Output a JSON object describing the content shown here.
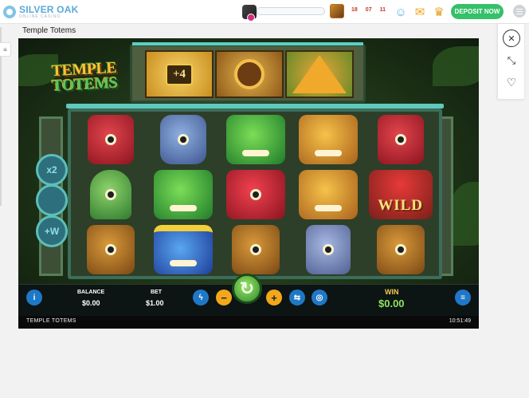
{
  "header": {
    "brand_name": "SILVER OAK",
    "brand_tagline": "ONLINE CASINO",
    "avatar_icon": "user-avatar-icon",
    "level_progress_fraction": 0.0,
    "promo_icon": "promo-chest-icon",
    "countdown": {
      "hours": "18",
      "minutes": "07",
      "seconds": "11"
    },
    "support_icon": "support-agent-icon",
    "mail_icon": "mail-icon",
    "trophy_icon": "trophy-icon",
    "deposit_label": "DEPOSIT NOW",
    "menu_icon": "hamburger-menu-icon",
    "accent_color": "#35c06a",
    "brand_color": "#5aa9d6"
  },
  "page": {
    "game_title": "Temple Totems"
  },
  "side_panel": {
    "close_icon": "close-icon",
    "expand_icon": "fullscreen-icon",
    "favorite_icon": "heart-icon"
  },
  "game": {
    "logo_line1": "TEMPLE",
    "logo_line2": "TOTEMS",
    "bonus_symbols": [
      {
        "name": "plus-four-bonus",
        "label": "+4"
      },
      {
        "name": "disc-bonus",
        "label": ""
      },
      {
        "name": "pyramid-bonus",
        "label": ""
      }
    ],
    "multipliers": [
      "x2",
      "",
      "+W"
    ],
    "reels": [
      [
        "red-totem",
        "green-idol",
        "skull-totem"
      ],
      [
        "blue-mask",
        "green-boar",
        "blue-fanged-mask"
      ],
      [
        "green-boar",
        "red-bird-mask",
        "skull-totem"
      ],
      [
        "gold-lion",
        "gold-lion",
        "eye-totem"
      ],
      [
        "red-totem",
        "wild",
        "skull-totem"
      ]
    ],
    "wild_label": "WILD",
    "controls": {
      "balance_label": "BALANCE",
      "balance_value": "$0.00",
      "bet_label": "BET",
      "bet_value": "$1.00",
      "win_label": "WIN",
      "win_value": "$0.00",
      "info_icon": "info-icon",
      "minus_label": "−",
      "plus_label": "+",
      "spin_icon": "spin-arrow-icon",
      "bolt_icon": "quick-spin-bolt-icon",
      "autoplay_icon": "autoplay-icon",
      "turbo_icon": "turbo-icon",
      "menu_icon": "game-menu-icon"
    },
    "status_title": "TEMPLE TOTEMS",
    "status_time": "10:51:49"
  }
}
